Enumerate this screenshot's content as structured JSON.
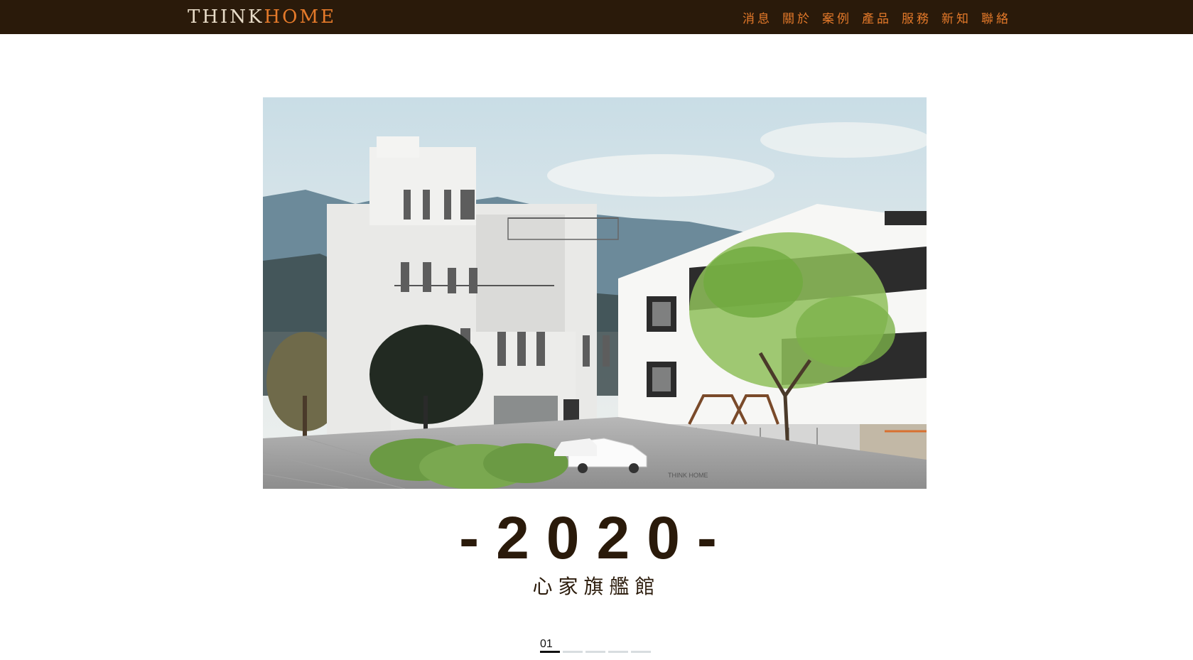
{
  "header": {
    "logo_think": "THINK",
    "logo_home": "HOME",
    "nav": [
      "消息",
      "關於",
      "案例",
      "產品",
      "服務",
      "新知",
      "聯絡"
    ]
  },
  "hero": {
    "image_label": "THINK HOME"
  },
  "slide": {
    "title": "-2020-",
    "subtitle": "心家旗艦館"
  },
  "pager": {
    "current": "01",
    "total_dots": 5,
    "active_index": 0
  },
  "colors": {
    "topbar": "#2a1a0a",
    "accent": "#e57a2a",
    "text_dark": "#2a1a0a"
  }
}
